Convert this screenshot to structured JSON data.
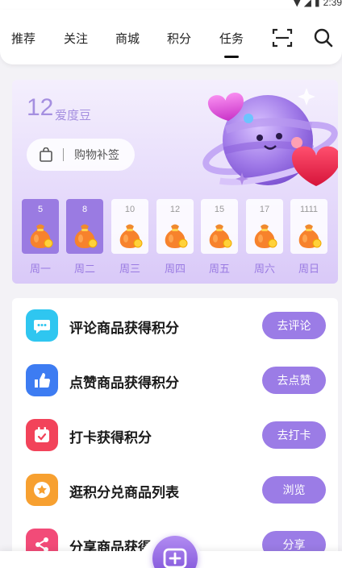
{
  "status_bar": {
    "time": "2:39"
  },
  "nav": {
    "tabs": [
      {
        "label": "推荐"
      },
      {
        "label": "关注"
      },
      {
        "label": "商城"
      },
      {
        "label": "积分"
      },
      {
        "label": "任务",
        "active": true
      }
    ],
    "icons": [
      "scan-icon",
      "search-icon"
    ]
  },
  "points": {
    "value": "12",
    "unit": "爱度豆"
  },
  "supplement": {
    "label": "购物补签",
    "icon": "shopping-bag-icon"
  },
  "week": [
    {
      "count": "5",
      "day": "周一",
      "done": true
    },
    {
      "count": "8",
      "day": "周二",
      "done": true
    },
    {
      "count": "10",
      "day": "周三",
      "done": false
    },
    {
      "count": "12",
      "day": "周四",
      "done": false
    },
    {
      "count": "15",
      "day": "周五",
      "done": false
    },
    {
      "count": "17",
      "day": "周六",
      "done": false
    },
    {
      "count": "1111",
      "day": "周日",
      "done": false
    }
  ],
  "tasks": [
    {
      "title": "评论商品获得积分",
      "button": "去评论",
      "icon": "comment-icon",
      "color": "#2fc6f0"
    },
    {
      "title": "点赞商品获得积分",
      "button": "去点赞",
      "icon": "thumb-up-icon",
      "color": "#3d7cf2"
    },
    {
      "title": "打卡获得积分",
      "button": "去打卡",
      "icon": "calendar-check-icon",
      "color": "#f2435a"
    },
    {
      "title": "逛积分兑商品列表",
      "button": "浏览",
      "icon": "star-badge-icon",
      "color": "#f7a030"
    },
    {
      "title": "分享商品获得积分",
      "button": "分享",
      "icon": "share-icon",
      "color": "#f24b78"
    }
  ],
  "colors": {
    "accent": "#9b7ce6",
    "points_text": "#a58fe0"
  }
}
